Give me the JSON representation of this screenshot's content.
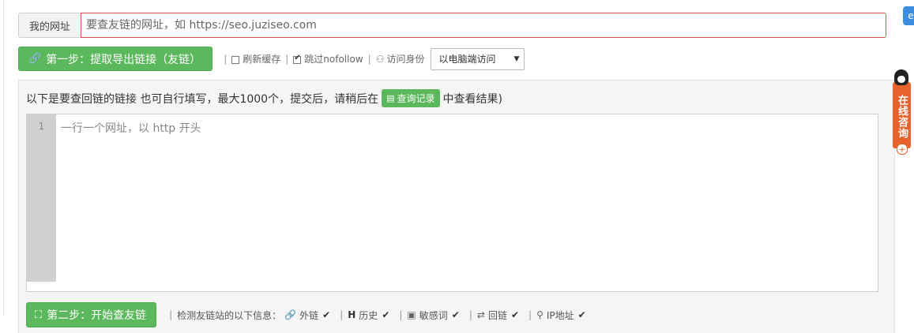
{
  "site": {
    "addon_label": "我的网址",
    "input_placeholder": "要查友链的网址，如 https://seo.juziseo.com",
    "input_value": ""
  },
  "step1": {
    "button_label": "第一步：提取导出链接（友链）",
    "button_icon": "link-icon",
    "refresh_cache_label": "刷新缓存",
    "refresh_cache_checked": false,
    "skip_nofollow_label": "跳过nofollow",
    "skip_nofollow_checked": true,
    "identity_label": "访问身份",
    "identity_icon": "user-icon",
    "identity_selected": "以电脑端访问"
  },
  "panel": {
    "title_prefix": "以下是要查回链的链接 也可自行填写，最大1000个，提交后，请稍后在",
    "history_button": "查询记录",
    "history_icon": "document-icon",
    "title_suffix": "中查看结果)",
    "line_number": "1",
    "editor_placeholder": "一行一个网址，以 http 开头"
  },
  "step2": {
    "button_label": "第二步：开始查友链",
    "button_icon": "sitemap-icon",
    "info_label": "检测友链站的以下信息：",
    "checks": [
      {
        "icon": "link-icon",
        "label": "外链"
      },
      {
        "icon": "history-icon",
        "label": "历史"
      },
      {
        "icon": "sensitive-word-icon",
        "label": "敏感词"
      },
      {
        "icon": "backlink-icon",
        "label": "回链"
      },
      {
        "icon": "location-icon",
        "label": "IP地址"
      }
    ]
  },
  "side": {
    "consult_label": "在线咨询",
    "consult_icon": "qq-penguin-icon"
  },
  "colors": {
    "green": "#5cb85c",
    "input_border_error": "#d9534f",
    "consult_orange": "#e8622c"
  }
}
